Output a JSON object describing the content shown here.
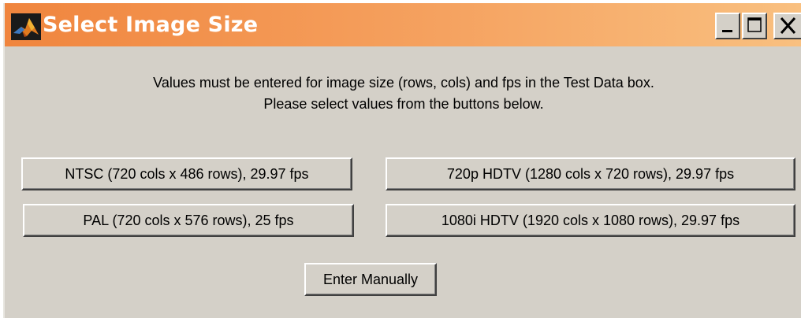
{
  "window": {
    "title": "Select Image Size",
    "controls": {
      "minimize": "minimize-icon",
      "maximize": "maximize-icon",
      "close": "close-icon"
    },
    "titlebar_gradient": [
      "#f0853e",
      "#f9c080"
    ],
    "body_color": "#d4d0c8"
  },
  "message": {
    "line1": "Values must be entered for image size (rows, cols) and fps in the Test Data box.",
    "line2": "Please select values from the buttons below."
  },
  "buttons": {
    "ntsc": "NTSC (720 cols x 486 rows), 29.97 fps",
    "pal": "PAL (720 cols x 576 rows), 25 fps",
    "hdtv720": "720p HDTV (1280 cols x 720 rows), 29.97 fps",
    "hdtv1080": "1080i HDTV (1920 cols x 1080 rows), 29.97 fps",
    "manual": "Enter Manually"
  }
}
